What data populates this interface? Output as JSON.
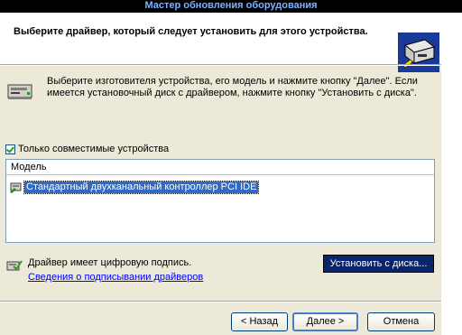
{
  "window": {
    "title": "Мастер обновления оборудования"
  },
  "header": {
    "title": "Выберите драйвер, который следует установить для этого устройства."
  },
  "info": {
    "text": "Выберите изготовителя устройства, его модель и нажмите кнопку \"Далее\". Если имеется установочный диск с  драйвером, нажмите кнопку \"Установить с диска\"."
  },
  "compatible": {
    "label": "Только совместимые устройства",
    "checked": true
  },
  "list": {
    "column_header": "Модель",
    "items": [
      {
        "label": "Стандартный двухканальный контроллер PCI IDE",
        "selected": true
      }
    ]
  },
  "signed": {
    "text": "Драйвер имеет цифровую подпись.",
    "link": "Сведения о подписывании драйверов"
  },
  "buttons": {
    "have_disk": "Установить с диска...",
    "back": "< Назад",
    "next": "Далее >",
    "cancel": "Отмена"
  },
  "icons": {
    "header": "hardware-install-icon",
    "info": "device-icon",
    "item": "controller-icon",
    "signed": "signed-driver-icon"
  },
  "colors": {
    "selection": "#316ac5",
    "link": "#0000ff",
    "dialog_bg": "#ece9d8"
  }
}
